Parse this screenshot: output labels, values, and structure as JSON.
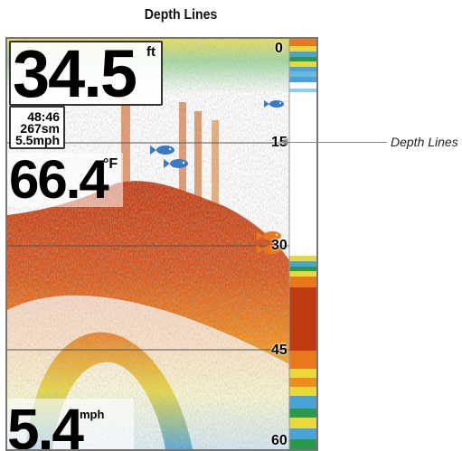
{
  "caption": "Depth Lines",
  "callout": "Depth Lines",
  "readouts": {
    "depth": {
      "value": "34.5",
      "unit": "ft"
    },
    "water_temp": {
      "value": "66.4",
      "unit": "°F"
    },
    "timer": "48:46",
    "distance": "267sm",
    "avg_speed": "5.5mph",
    "speed": {
      "value": "5.4",
      "unit": "mph"
    }
  },
  "depth_scale": [
    "0",
    "15",
    "30",
    "45",
    "60"
  ],
  "colors": {
    "strong_return": "#c23a12",
    "mid_return": "#f08c1c",
    "weak_return": "#4aa3d8",
    "fish_blue": "#3a78c8",
    "fish_orange": "#e8781c"
  },
  "icons": {
    "fish": "fish-icon"
  }
}
